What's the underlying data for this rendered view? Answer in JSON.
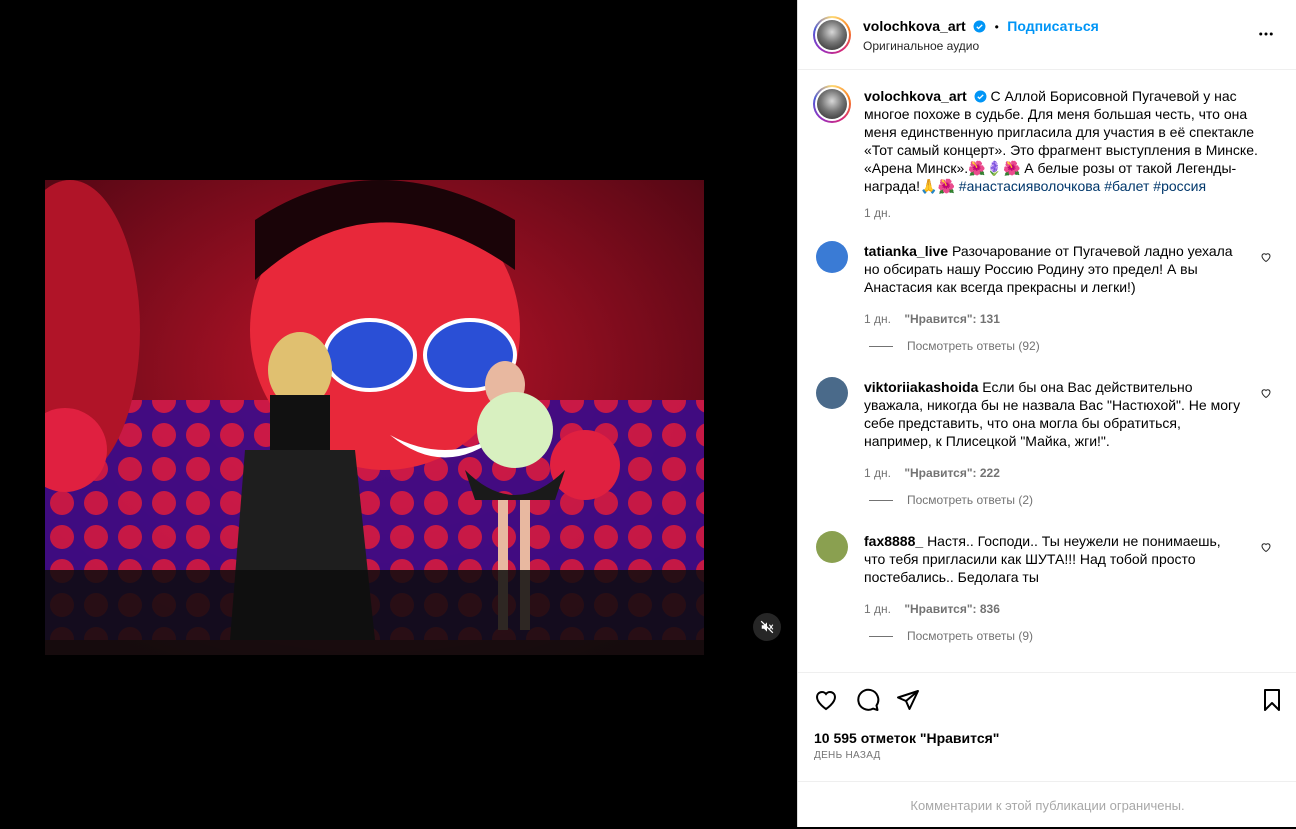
{
  "post": {
    "username": "volochkova_art",
    "follow_label": "Подписаться",
    "separator": "•",
    "audio_label": "Оригинальное аудио",
    "more_label": "···"
  },
  "caption": {
    "username": "volochkova_art",
    "text": "С Аллой Борисовной Пугачевой у нас многое похоже в судьбе. Для меня большая честь, что она меня единственную пригласила для участия в её спектакле «Тот самый концерт». Это фрагмент выступления в Минске. «Арена Минск».🌺🪻🌺 А белые розы от такой Легенды- награда!🙏🌺 ",
    "hashtags": [
      "#анастасияволочкова",
      "#балет",
      "#россия"
    ],
    "time": "1 дн."
  },
  "comments": [
    {
      "username": "tatianka_live",
      "text": "Разочарование от Пугачевой ладно уехала но обсирать нашу Россию Родину это предел! А вы Анастасия как всегда прекрасны и легки!)",
      "time": "1 дн.",
      "likes": "\"Нравится\": 131",
      "replies": "Посмотреть ответы (92)",
      "avatar_color": "#3a7bd5"
    },
    {
      "username": "viktoriiakashoida",
      "text": "Если бы она Вас действительно уважала, никогда бы не назвала Вас \"Настюхой\". Не могу себе представить, что она могла бы обратиться, например, к Плисецкой \"Майка, жги!\".",
      "time": "1 дн.",
      "likes": "\"Нравится\": 222",
      "replies": "Посмотреть ответы (2)",
      "avatar_color": "#4a6a8a"
    },
    {
      "username": "fax8888_",
      "text": "Настя.. Господи.. Ты неужели не понимаешь, что тебя пригласили как ШУТА!!! Над тобой просто постебались.. Бедолага ты",
      "time": "1 дн.",
      "likes": "\"Нравится\": 836",
      "replies": "Посмотреть ответы (9)",
      "avatar_color": "#8aa050"
    }
  ],
  "engagement": {
    "likes_text": "10 595 отметок \"Нравится\"",
    "date_text": "ДЕНЬ НАЗАД",
    "comments_limited": "Комментарии к этой публикации ограничены."
  },
  "colors": {
    "accent": "#0095f6",
    "hashtag": "#00376b",
    "muted": "#737373",
    "verified": "#0095f6"
  },
  "icons": {
    "like": "heart-icon",
    "comment": "comment-icon",
    "share": "share-icon",
    "save": "bookmark-icon",
    "mute": "muted-speaker-icon"
  }
}
